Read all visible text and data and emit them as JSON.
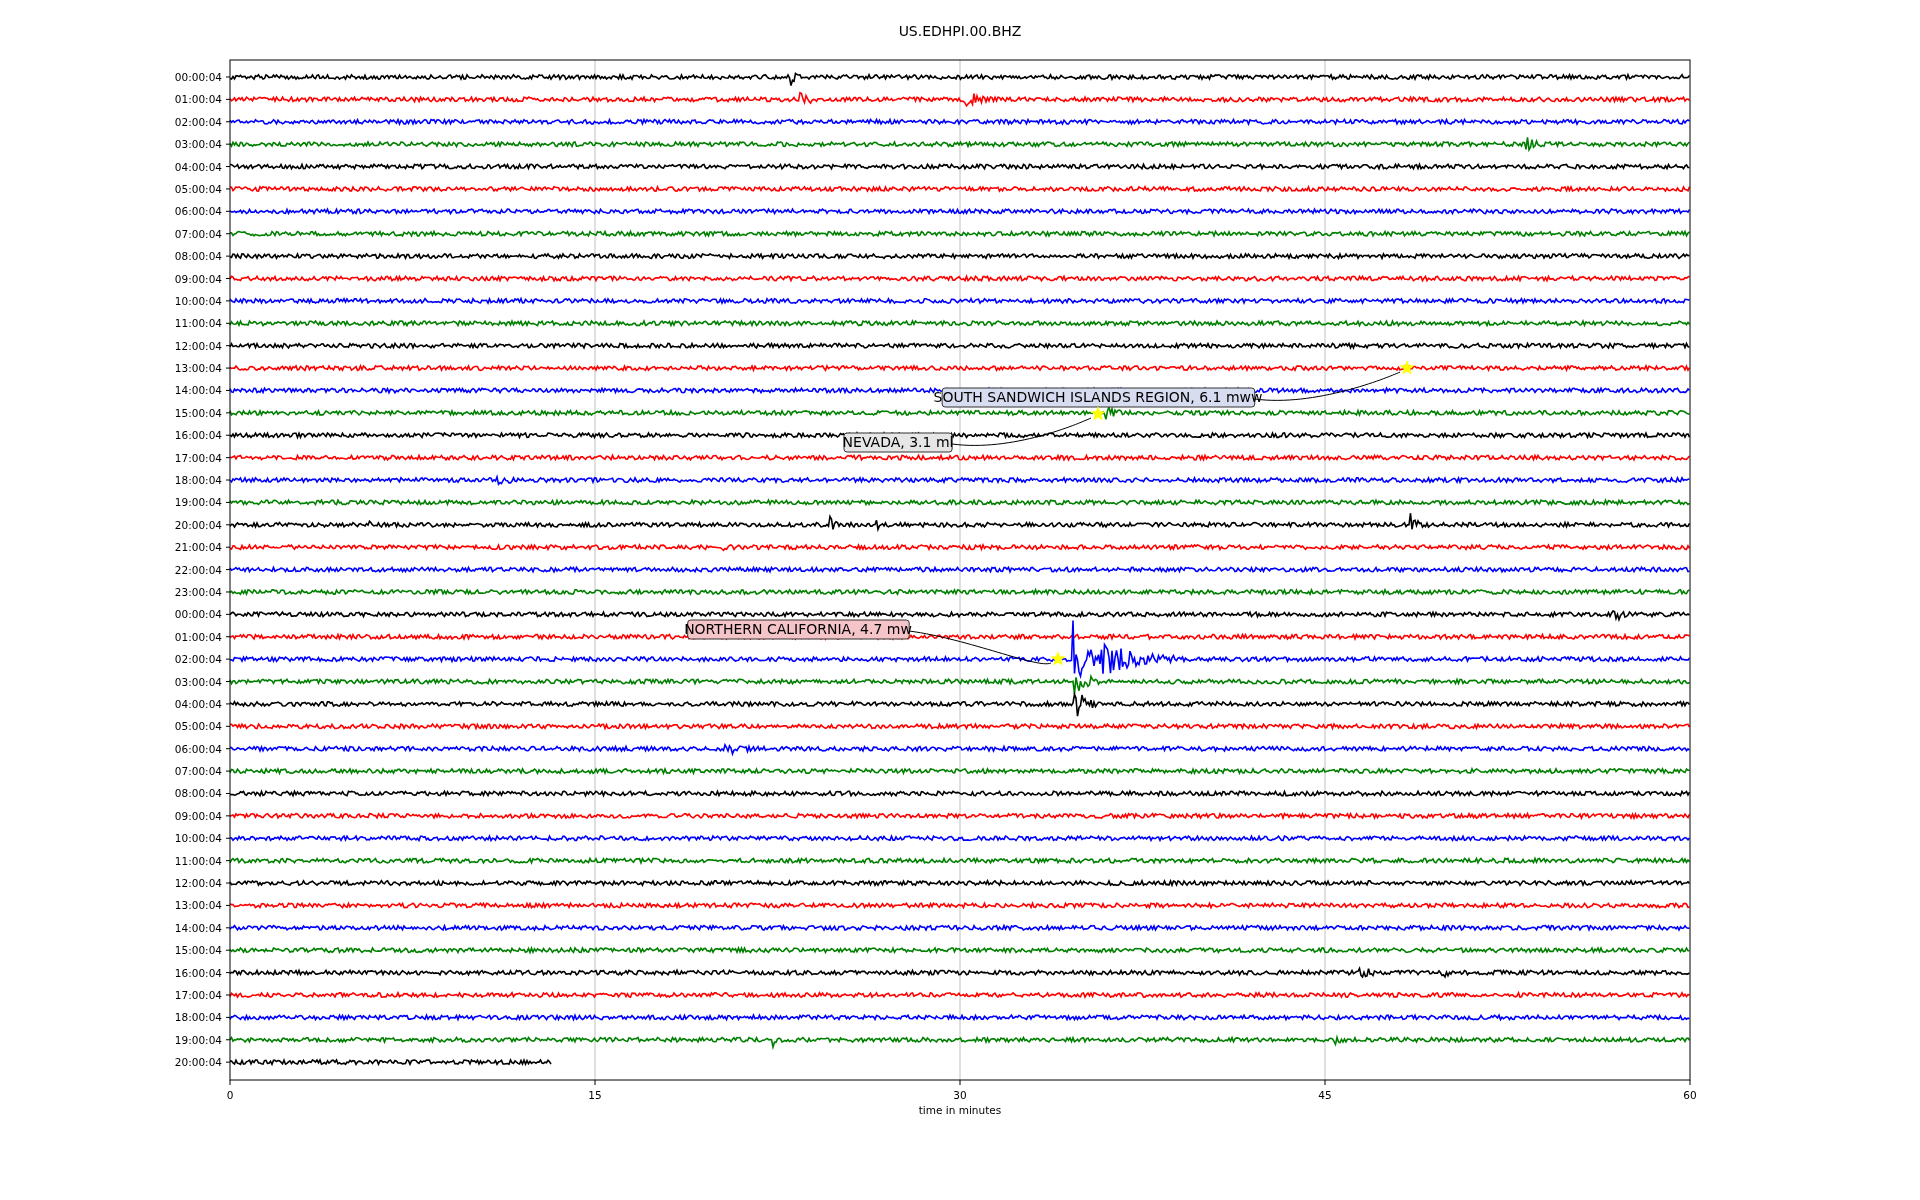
{
  "figure": {
    "title": "US.EDHPI.00.BHZ",
    "xlabel": "time in minutes",
    "xticks": [
      "0",
      "15",
      "30",
      "45",
      "60"
    ],
    "rows": [
      {
        "label": "00:00:04",
        "color": "#000000"
      },
      {
        "label": "01:00:04",
        "color": "#ff0000"
      },
      {
        "label": "02:00:04",
        "color": "#0000ff"
      },
      {
        "label": "03:00:04",
        "color": "#008000"
      },
      {
        "label": "04:00:04",
        "color": "#000000"
      },
      {
        "label": "05:00:04",
        "color": "#ff0000"
      },
      {
        "label": "06:00:04",
        "color": "#0000ff"
      },
      {
        "label": "07:00:04",
        "color": "#008000"
      },
      {
        "label": "08:00:04",
        "color": "#000000"
      },
      {
        "label": "09:00:04",
        "color": "#ff0000"
      },
      {
        "label": "10:00:04",
        "color": "#0000ff"
      },
      {
        "label": "11:00:04",
        "color": "#008000"
      },
      {
        "label": "12:00:04",
        "color": "#000000"
      },
      {
        "label": "13:00:04",
        "color": "#ff0000"
      },
      {
        "label": "14:00:04",
        "color": "#0000ff"
      },
      {
        "label": "15:00:04",
        "color": "#008000"
      },
      {
        "label": "16:00:04",
        "color": "#000000"
      },
      {
        "label": "17:00:04",
        "color": "#ff0000"
      },
      {
        "label": "18:00:04",
        "color": "#0000ff"
      },
      {
        "label": "19:00:04",
        "color": "#008000"
      },
      {
        "label": "20:00:04",
        "color": "#000000"
      },
      {
        "label": "21:00:04",
        "color": "#ff0000"
      },
      {
        "label": "22:00:04",
        "color": "#0000ff"
      },
      {
        "label": "23:00:04",
        "color": "#008000"
      },
      {
        "label": "00:00:04",
        "color": "#000000"
      },
      {
        "label": "01:00:04",
        "color": "#ff0000"
      },
      {
        "label": "02:00:04",
        "color": "#0000ff"
      },
      {
        "label": "03:00:04",
        "color": "#008000"
      },
      {
        "label": "04:00:04",
        "color": "#000000"
      },
      {
        "label": "05:00:04",
        "color": "#ff0000"
      },
      {
        "label": "06:00:04",
        "color": "#0000ff"
      },
      {
        "label": "07:00:04",
        "color": "#008000"
      },
      {
        "label": "08:00:04",
        "color": "#000000"
      },
      {
        "label": "09:00:04",
        "color": "#ff0000"
      },
      {
        "label": "10:00:04",
        "color": "#0000ff"
      },
      {
        "label": "11:00:04",
        "color": "#008000"
      },
      {
        "label": "12:00:04",
        "color": "#000000"
      },
      {
        "label": "13:00:04",
        "color": "#ff0000"
      },
      {
        "label": "14:00:04",
        "color": "#0000ff"
      },
      {
        "label": "15:00:04",
        "color": "#008000"
      },
      {
        "label": "16:00:04",
        "color": "#000000"
      },
      {
        "label": "17:00:04",
        "color": "#ff0000"
      },
      {
        "label": "18:00:04",
        "color": "#0000ff"
      },
      {
        "label": "19:00:04",
        "color": "#008000"
      },
      {
        "label": "20:00:04",
        "color": "#000000"
      }
    ],
    "events": [
      {
        "text": "SOUTH SANDWICH ISLANDS REGION, 6.1 mww",
        "color": "#d8dcf0"
      },
      {
        "text": "NEVADA, 3.1 ml",
        "color": "#e6e6e6"
      },
      {
        "text": "NORTHERN CALIFORNIA, 4.7 mw",
        "color": "#f4c4c8"
      }
    ]
  }
}
